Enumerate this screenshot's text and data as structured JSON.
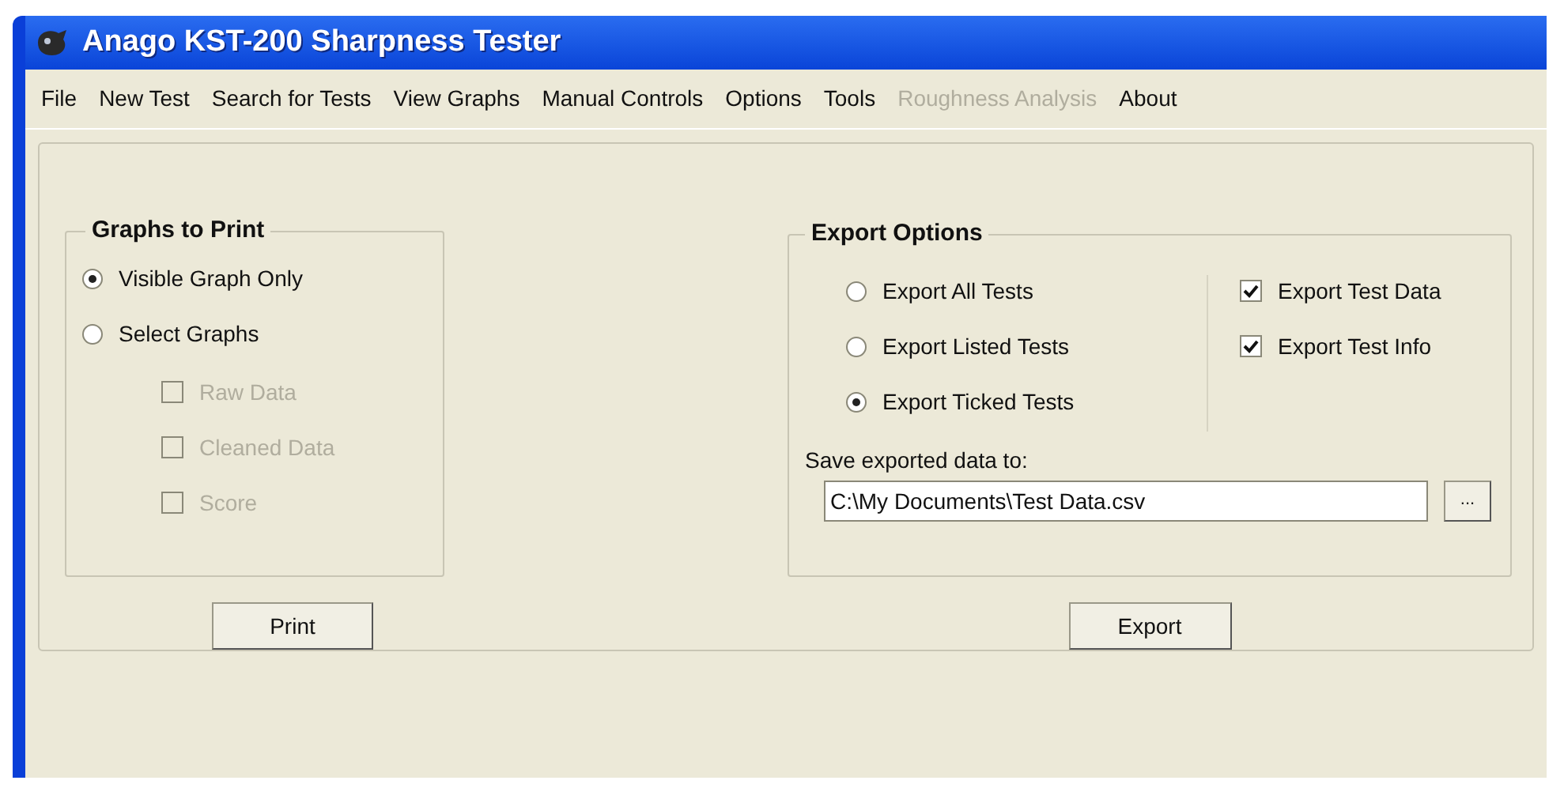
{
  "window": {
    "title": "Anago KST-200 Sharpness Tester"
  },
  "menu": [
    {
      "label": "File",
      "disabled": false
    },
    {
      "label": "New Test",
      "disabled": false
    },
    {
      "label": "Search for Tests",
      "disabled": false
    },
    {
      "label": "View Graphs",
      "disabled": false
    },
    {
      "label": "Manual Controls",
      "disabled": false
    },
    {
      "label": "Options",
      "disabled": false
    },
    {
      "label": "Tools",
      "disabled": false
    },
    {
      "label": "Roughness Analysis",
      "disabled": true
    },
    {
      "label": "About",
      "disabled": false
    }
  ],
  "graphs_to_print": {
    "title": "Graphs to Print",
    "options": [
      {
        "label": "Visible Graph Only",
        "selected": true
      },
      {
        "label": "Select Graphs",
        "selected": false
      }
    ],
    "graphs": [
      {
        "label": "Raw Data",
        "checked": false,
        "disabled": true
      },
      {
        "label": "Cleaned Data",
        "checked": false,
        "disabled": true
      },
      {
        "label": "Score",
        "checked": false,
        "disabled": true
      }
    ],
    "button": "Print"
  },
  "export_options": {
    "title": "Export Options",
    "options": [
      {
        "label": "Export All Tests",
        "selected": false
      },
      {
        "label": "Export Listed Tests",
        "selected": false
      },
      {
        "label": "Export Ticked Tests",
        "selected": true
      }
    ],
    "includes": [
      {
        "label": "Export Test Data",
        "checked": true,
        "disabled": false
      },
      {
        "label": "Export Test Info",
        "checked": true,
        "disabled": false
      }
    ],
    "path_label": "Save exported data to:",
    "path": "C:\\My Documents\\Test Data.csv",
    "browse": "...",
    "button": "Export"
  }
}
